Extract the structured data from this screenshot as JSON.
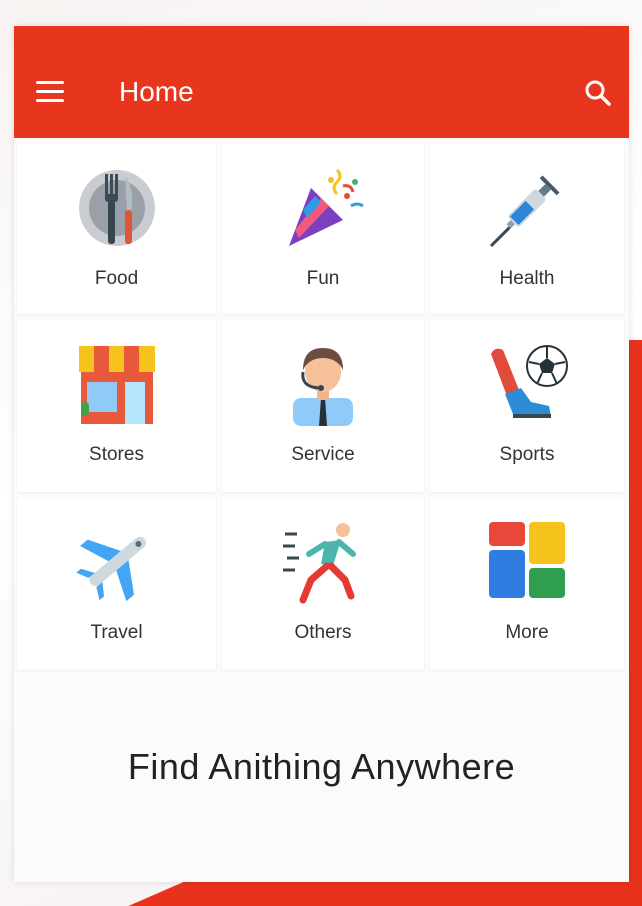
{
  "header": {
    "title": "Home",
    "menu_icon": "menu-icon",
    "search_icon": "search-icon"
  },
  "categories": [
    {
      "label": "Food",
      "icon": "food-icon"
    },
    {
      "label": "Fun",
      "icon": "party-popper-icon"
    },
    {
      "label": "Health",
      "icon": "syringe-icon"
    },
    {
      "label": "Stores",
      "icon": "store-icon"
    },
    {
      "label": "Service",
      "icon": "customer-service-icon"
    },
    {
      "label": "Sports",
      "icon": "soccer-icon"
    },
    {
      "label": "Travel",
      "icon": "airplane-icon"
    },
    {
      "label": "Others",
      "icon": "running-man-icon"
    },
    {
      "label": "More",
      "icon": "more-grid-icon"
    }
  ],
  "tagline": "Find Anithing Anywhere",
  "colors": {
    "accent": "#e8351e",
    "background": "#fbfbfb"
  }
}
